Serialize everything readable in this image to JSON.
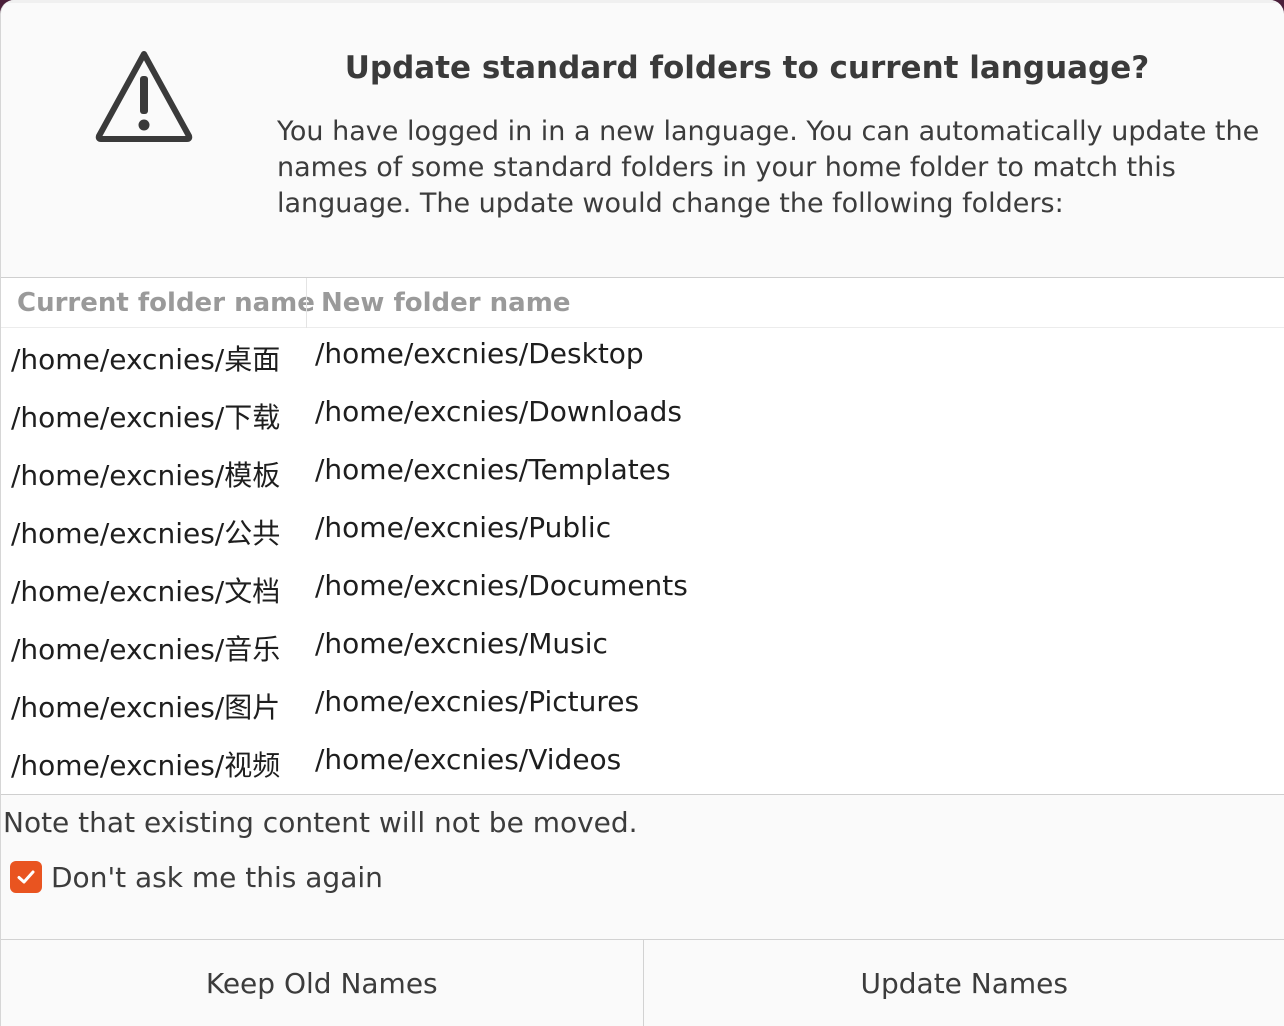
{
  "dialog": {
    "title": "Update standard folders to current language?",
    "message": "You have logged in in a new language. You can automatically update the names of some standard folders in your home folder to match this language. The update would change the following folders:",
    "icon": "warning-icon"
  },
  "table": {
    "headers": {
      "current": "Current folder name",
      "new": "New folder name"
    },
    "rows": [
      {
        "current": "/home/excnies/桌面",
        "new": "/home/excnies/Desktop"
      },
      {
        "current": "/home/excnies/下载",
        "new": "/home/excnies/Downloads"
      },
      {
        "current": "/home/excnies/模板",
        "new": "/home/excnies/Templates"
      },
      {
        "current": "/home/excnies/公共",
        "new": "/home/excnies/Public"
      },
      {
        "current": "/home/excnies/文档",
        "new": "/home/excnies/Documents"
      },
      {
        "current": "/home/excnies/音乐",
        "new": "/home/excnies/Music"
      },
      {
        "current": "/home/excnies/图片",
        "new": "/home/excnies/Pictures"
      },
      {
        "current": "/home/excnies/视频",
        "new": "/home/excnies/Videos"
      }
    ]
  },
  "note": "Note that existing content will not be moved.",
  "dont_ask": {
    "label": "Don't ask me this again",
    "checked": true
  },
  "buttons": {
    "keep": "Keep Old Names",
    "update": "Update Names"
  },
  "colors": {
    "accent": "#e95420",
    "background": "#fafafa",
    "text": "#3c3c3c"
  }
}
